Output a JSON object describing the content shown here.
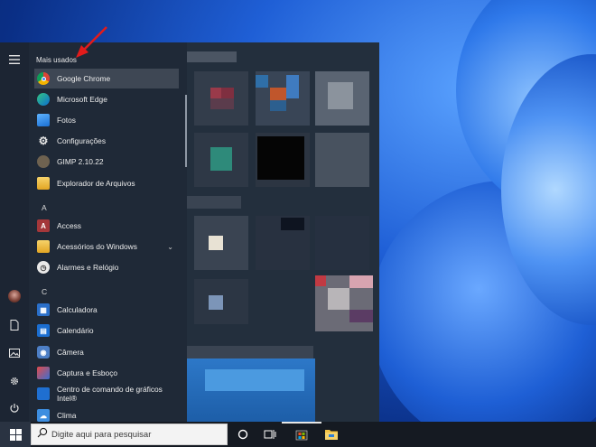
{
  "start_menu": {
    "most_used_header": "Mais usados",
    "most_used": [
      {
        "label": "Google Chrome",
        "icon": "chrome-icon",
        "active": true
      },
      {
        "label": "Microsoft Edge",
        "icon": "edge-icon"
      },
      {
        "label": "Fotos",
        "icon": "photos-icon"
      },
      {
        "label": "Configurações",
        "icon": "settings-gear-icon"
      },
      {
        "label": "GIMP 2.10.22",
        "icon": "gimp-icon"
      },
      {
        "label": "Explorador de Arquivos",
        "icon": "folder-icon"
      }
    ],
    "group_a": {
      "letter": "A",
      "items": [
        {
          "label": "Access",
          "icon": "access-icon"
        },
        {
          "label": "Acessórios do Windows",
          "icon": "folder-icon",
          "expandable": true
        },
        {
          "label": "Alarmes e Relógio",
          "icon": "clock-icon"
        }
      ]
    },
    "group_c": {
      "letter": "C",
      "items": [
        {
          "label": "Calculadora",
          "icon": "calculator-icon"
        },
        {
          "label": "Calendário",
          "icon": "calendar-icon"
        },
        {
          "label": "Câmera",
          "icon": "camera-icon"
        },
        {
          "label": "Captura e Esboço",
          "icon": "snip-icon"
        },
        {
          "label": "Centro de comando de gráficos Intel®",
          "icon": "intel-graphics-icon"
        },
        {
          "label": "Clima",
          "icon": "weather-icon"
        }
      ]
    }
  },
  "taskbar": {
    "search_placeholder": "Digite aqui para pesquisar",
    "icons": [
      "windows-start-icon",
      "search-icon",
      "cortana-icon",
      "task-view-icon",
      "store-icon",
      "file-explorer-icon"
    ]
  },
  "colors": {
    "menu_bg": "#1f2937",
    "taskbar_bg": "#151a22",
    "arrow": "#e21b1b"
  }
}
